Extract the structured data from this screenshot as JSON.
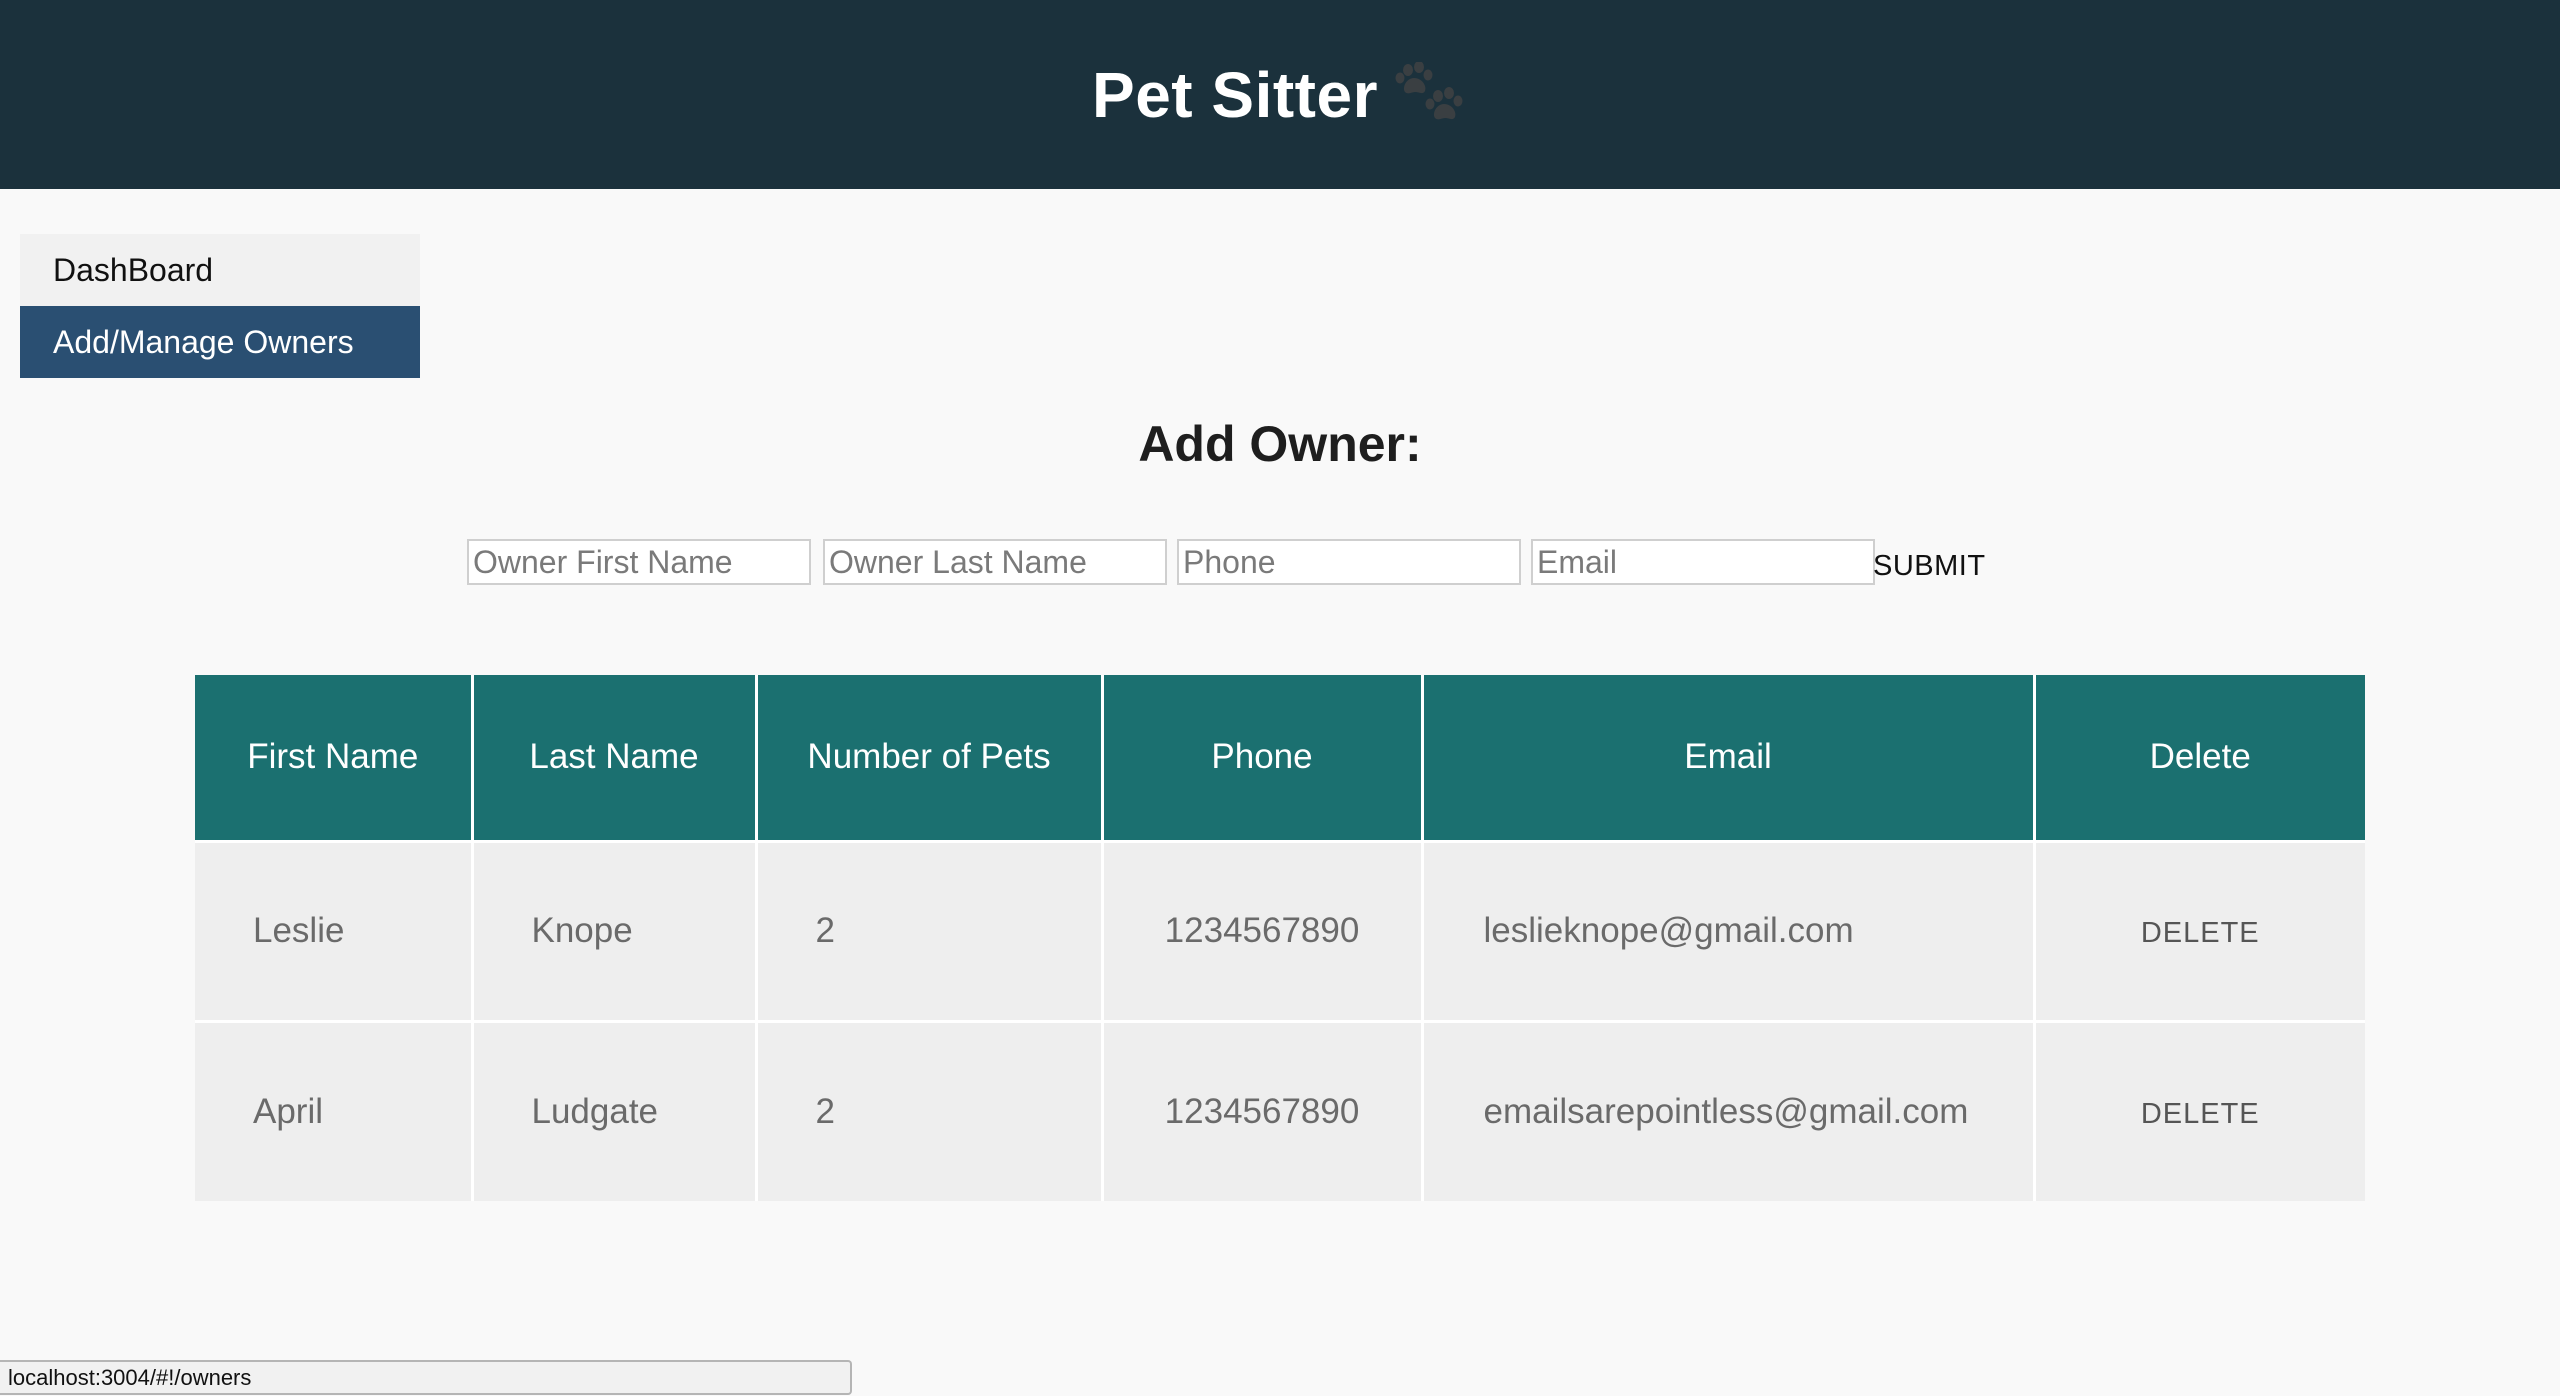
{
  "header": {
    "title": "Pet Sitter",
    "icon": "paw-icon"
  },
  "nav": {
    "items": [
      {
        "label": "DashBoard",
        "active": false
      },
      {
        "label": "Add/Manage Owners",
        "active": true
      }
    ]
  },
  "form": {
    "title": "Add Owner:",
    "first_name_placeholder": "Owner First Name",
    "last_name_placeholder": "Owner Last Name",
    "phone_placeholder": "Phone",
    "email_placeholder": "Email",
    "submit_label": "SUBMIT"
  },
  "table": {
    "headers": [
      "First Name",
      "Last Name",
      "Number of Pets",
      "Phone",
      "Email",
      "Delete"
    ],
    "rows": [
      {
        "first_name": "Leslie",
        "last_name": "Knope",
        "pets": "2",
        "phone": "1234567890",
        "email": "leslieknope@gmail.com",
        "delete_label": "DELETE"
      },
      {
        "first_name": "April",
        "last_name": "Ludgate",
        "pets": "2",
        "phone": "1234567890",
        "email": "emailsarepointless@gmail.com",
        "delete_label": "DELETE"
      }
    ]
  },
  "status_bar": {
    "url": "localhost:3004/#!/owners"
  },
  "colors": {
    "header_bg": "#1b313c",
    "nav_active_bg": "#2a4f72",
    "table_header_bg": "#1b7070",
    "table_row_bg": "#eeeeee"
  }
}
